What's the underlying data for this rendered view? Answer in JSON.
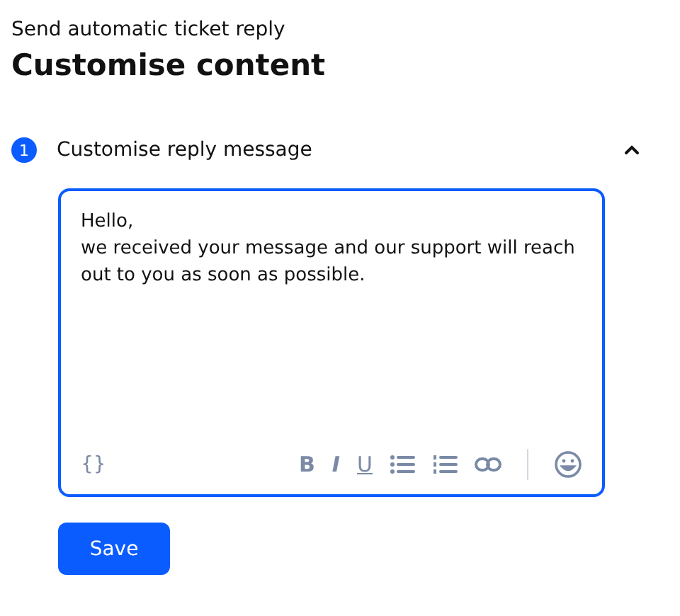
{
  "subtitle": "Send automatic ticket reply",
  "title": "Customise content",
  "step": {
    "number": "1",
    "label": "Customise reply message",
    "expanded": true
  },
  "editor": {
    "value": "Hello,\nwe received your message and our support will reach out to you as soon as possible.",
    "toolbar_left": [
      {
        "kind": "text",
        "label": "{}"
      }
    ],
    "toolbar_right": [
      {
        "kind": "bold",
        "label": "B"
      },
      {
        "kind": "italic",
        "label": "I"
      },
      {
        "kind": "underline",
        "label": "U"
      },
      {
        "kind": "bullet-list"
      },
      {
        "kind": "numbered-list"
      },
      {
        "kind": "link"
      },
      {
        "kind": "divider"
      },
      {
        "kind": "emoji"
      }
    ]
  },
  "buttons": [
    {
      "label": "Save"
    }
  ]
}
